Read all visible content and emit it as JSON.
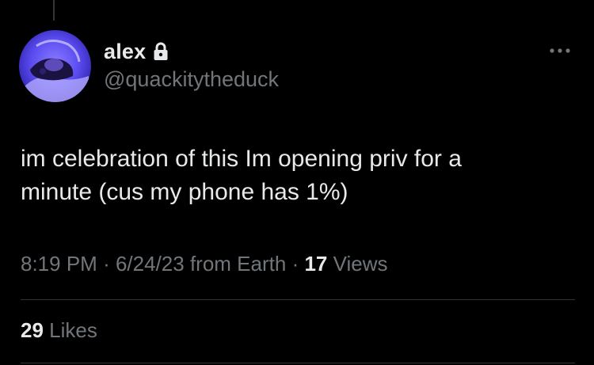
{
  "user": {
    "display_name": "alex",
    "handle": "@quackitytheduck",
    "protected": true
  },
  "tweet": {
    "text": "im celebration of this Im opening priv for a\nminute (cus my phone has 1%)",
    "time": "8:19 PM",
    "date": "6/24/23",
    "source": "from Earth",
    "separator": "·",
    "views_count": "17",
    "views_label": "Views"
  },
  "engagement": {
    "likes_count": "29",
    "likes_label": "Likes"
  },
  "icons": {
    "lock": "lock-icon",
    "more": "more-horizontal-icon"
  },
  "colors": {
    "background": "#000000",
    "primary_text": "#e7e9ea",
    "secondary_text": "#71767b",
    "divider": "#2f3336",
    "avatar_tint": "#5a4cf0"
  }
}
